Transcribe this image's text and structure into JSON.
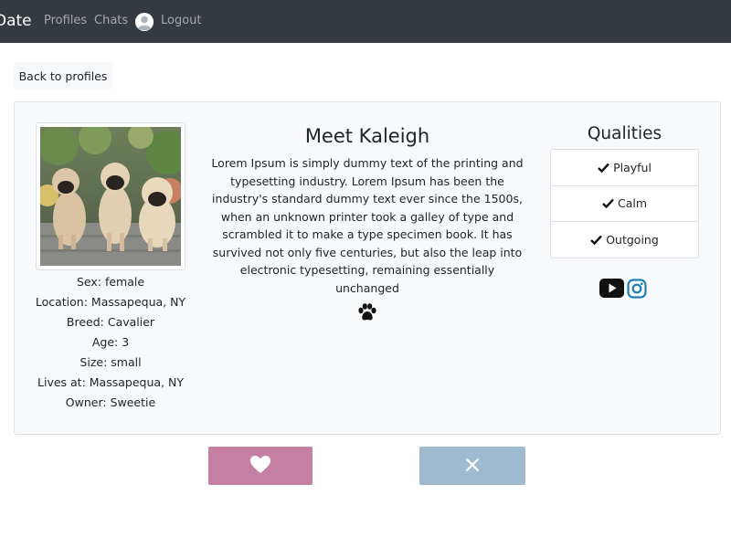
{
  "nav": {
    "brand": "Date",
    "links": [
      {
        "label": "Profiles"
      },
      {
        "label": "Chats"
      },
      {
        "label": "Logout"
      }
    ]
  },
  "back_button": {
    "label": "Back to profiles"
  },
  "profile": {
    "title": "Meet Kaleigh",
    "description": "Lorem Ipsum is simply dummy text of the printing and typesetting industry. Lorem Ipsum has been the industry's standard dummy text ever since the 1500s, when an unknown printer took a galley of type and scrambled it to make a type specimen book. It has survived not only five centuries, but also the leap into electronic typesetting, remaining essentially unchanged",
    "details": [
      "Sex: female",
      "Location: Massapequa, NY",
      "Breed: Cavalier",
      "Age: 3",
      "Size: small",
      "Lives at: Massapequa, NY",
      "Owner: Sweetie"
    ]
  },
  "qualities": {
    "title": "Qualities",
    "items": [
      "Playful",
      "Calm",
      "Outgoing"
    ]
  },
  "icons": {
    "avatar": "user-avatar-icon",
    "paw": "paw-icon",
    "check": "check-icon",
    "youtube": "youtube-icon",
    "instagram": "instagram-icon",
    "like": "heart-icon",
    "pass": "close-icon"
  },
  "colors": {
    "navbar": "#343a40",
    "like_button": "#c47fa3",
    "pass_button": "#9fbace",
    "instagram": "#1f7fb3"
  }
}
